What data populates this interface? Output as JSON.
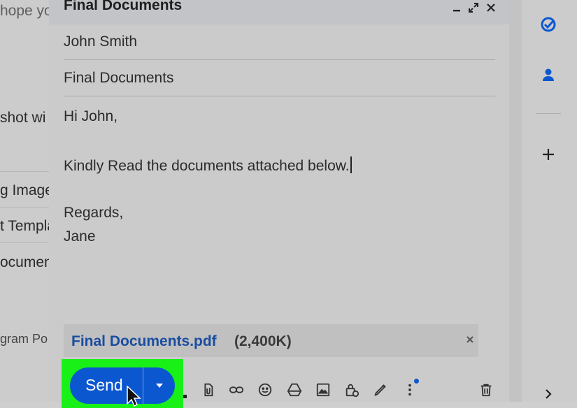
{
  "background_list": {
    "items": [
      {
        "text": "hope yo"
      },
      {
        "text": "shot wi"
      },
      {
        "text": "g Image"
      },
      {
        "text": "t Templa"
      },
      {
        "text": "ocumen"
      },
      {
        "text": "gram Po"
      }
    ]
  },
  "compose": {
    "title": "Final Documents",
    "to": "John Smith",
    "subject": "Final Documents",
    "body": {
      "greeting": "Hi John,",
      "line1": "Kindly Read the documents attached below.",
      "closing": "Regards,",
      "signature": "Jane"
    },
    "attachment": {
      "name": "Final Documents.pdf",
      "size": "(2,400K)"
    },
    "send_label": "Send"
  },
  "side_panel": {
    "icons": [
      "tasks-icon",
      "contacts-icon",
      "add-icon",
      "expand-chevron-icon"
    ]
  },
  "colors": {
    "accent": "#0b57d0",
    "highlight": "#18f018",
    "attachment_link": "#1a4da0"
  }
}
